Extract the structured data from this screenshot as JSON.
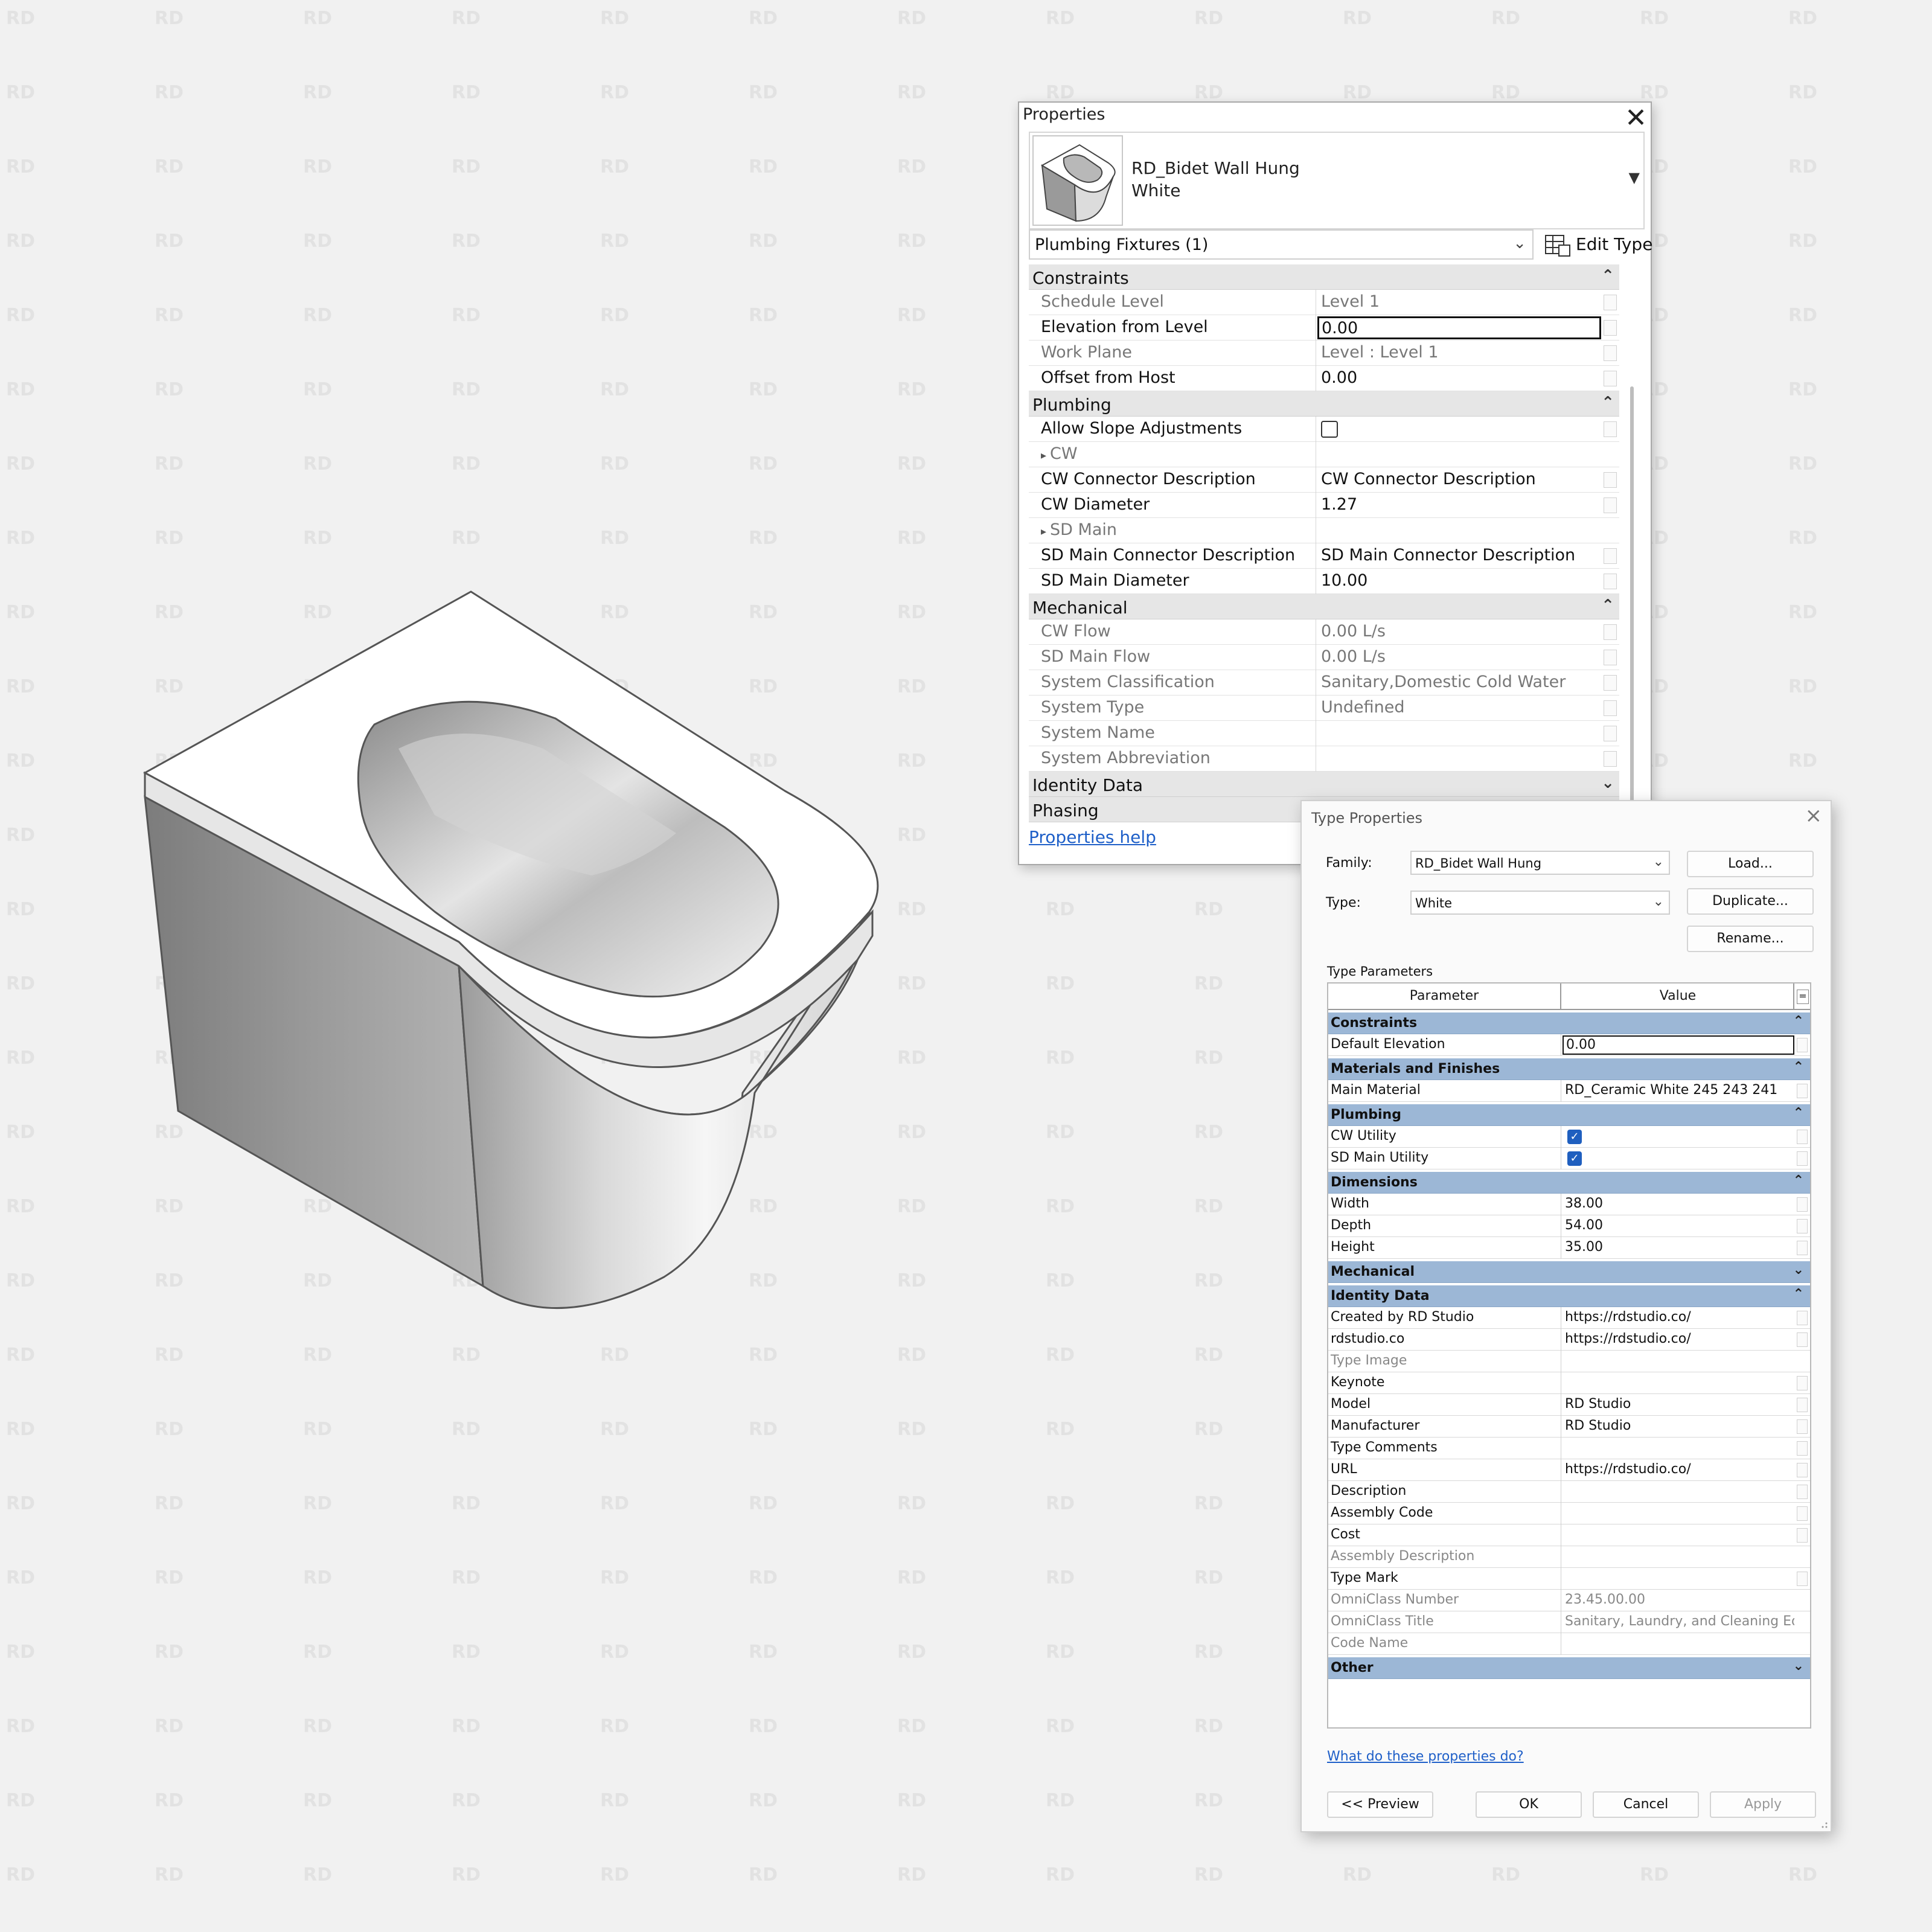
{
  "watermark": "RD",
  "properties": {
    "title": "Properties",
    "close_glyph": "✕",
    "type_family": "RD_Bidet Wall Hung",
    "type_name": "White",
    "category_filter": "Plumbing Fixtures (1)",
    "edit_type_label": "Edit Type",
    "help_link": "Properties help",
    "groups": [
      {
        "label": "Constraints",
        "expanded": true,
        "rows": [
          {
            "name": "Schedule Level",
            "value": "Level 1",
            "dim": true
          },
          {
            "name": "Elevation from Level",
            "value": "0.00",
            "editing": true
          },
          {
            "name": "Work Plane",
            "value": "Level : Level 1",
            "dim": true
          },
          {
            "name": "Offset from Host",
            "value": "0.00"
          }
        ]
      },
      {
        "label": "Plumbing",
        "expanded": true,
        "rows": [
          {
            "name": "Allow Slope Adjustments",
            "checkbox": true,
            "checked": false
          },
          {
            "name": "CW",
            "subgroup": true
          },
          {
            "name": "CW Connector Description",
            "value": "CW Connector Description"
          },
          {
            "name": "CW Diameter",
            "value": "1.27"
          },
          {
            "name": "SD Main",
            "subgroup": true
          },
          {
            "name": "SD Main Connector Description",
            "value": "SD Main Connector Description"
          },
          {
            "name": "SD Main Diameter",
            "value": "10.00"
          }
        ]
      },
      {
        "label": "Mechanical",
        "expanded": true,
        "rows": [
          {
            "name": "CW Flow",
            "value": "0.00 L/s",
            "dim": true
          },
          {
            "name": "SD Main Flow",
            "value": "0.00 L/s",
            "dim": true
          },
          {
            "name": "System Classification",
            "value": "Sanitary,Domestic Cold Water",
            "dim": true
          },
          {
            "name": "System Type",
            "value": "Undefined",
            "dim": true
          },
          {
            "name": "System Name",
            "value": "",
            "dim": true
          },
          {
            "name": "System Abbreviation",
            "value": "",
            "dim": true
          }
        ]
      },
      {
        "label": "Identity Data",
        "expanded": false,
        "rows": []
      },
      {
        "label": "Phasing",
        "expanded": false,
        "rows": []
      }
    ]
  },
  "type_properties": {
    "title": "Type Properties",
    "family_label": "Family:",
    "family_value": "RD_Bidet Wall Hung",
    "type_label": "Type:",
    "type_value": "White",
    "load_button": "Load...",
    "duplicate_button": "Duplicate...",
    "rename_button": "Rename...",
    "grid_title": "Type Parameters",
    "col_parameter": "Parameter",
    "col_value": "Value",
    "col_sort": "=",
    "groups": [
      {
        "label": "Constraints",
        "expanded": true,
        "rows": [
          {
            "name": "Default Elevation",
            "value": "0.00",
            "editing": true
          }
        ]
      },
      {
        "label": "Materials and Finishes",
        "expanded": true,
        "rows": [
          {
            "name": "Main Material",
            "value": "RD_Ceramic White 245 243 241"
          }
        ]
      },
      {
        "label": "Plumbing",
        "expanded": true,
        "rows": [
          {
            "name": "CW Utility",
            "checkbox": true
          },
          {
            "name": "SD Main Utility",
            "checkbox": true
          }
        ]
      },
      {
        "label": "Dimensions",
        "expanded": true,
        "rows": [
          {
            "name": "Width",
            "value": "38.00"
          },
          {
            "name": "Depth",
            "value": "54.00"
          },
          {
            "name": "Height",
            "value": "35.00"
          }
        ]
      },
      {
        "label": "Mechanical",
        "expanded": false,
        "rows": []
      },
      {
        "label": "Identity Data",
        "expanded": true,
        "rows": [
          {
            "name": "Created by RD Studio",
            "value": "https://rdstudio.co/"
          },
          {
            "name": "rdstudio.co",
            "value": "https://rdstudio.co/"
          },
          {
            "name": "Type Image",
            "value": "",
            "dim": true
          },
          {
            "name": "Keynote",
            "value": ""
          },
          {
            "name": "Model",
            "value": "RD Studio"
          },
          {
            "name": "Manufacturer",
            "value": "RD Studio"
          },
          {
            "name": "Type Comments",
            "value": ""
          },
          {
            "name": "URL",
            "value": "https://rdstudio.co/"
          },
          {
            "name": "Description",
            "value": ""
          },
          {
            "name": "Assembly Code",
            "value": ""
          },
          {
            "name": "Cost",
            "value": ""
          },
          {
            "name": "Assembly Description",
            "value": "",
            "dim": true
          },
          {
            "name": "Type Mark",
            "value": ""
          },
          {
            "name": "OmniClass Number",
            "value": "23.45.00.00",
            "dim": true
          },
          {
            "name": "OmniClass Title",
            "value": "Sanitary, Laundry, and Cleaning Eq",
            "dim": true
          },
          {
            "name": "Code Name",
            "value": "",
            "dim": true
          }
        ]
      },
      {
        "label": "Other",
        "expanded": false,
        "rows": []
      }
    ],
    "help_link": "What do these properties do?",
    "preview_button": "<< Preview",
    "ok_button": "OK",
    "cancel_button": "Cancel",
    "apply_button": "Apply"
  },
  "colors": {
    "background": "#f1f1f1",
    "watermark": "#e2e2e2",
    "group_header_tp": "#9cb7d6",
    "link": "#1e5fc8",
    "check": "#1f5fbf"
  }
}
